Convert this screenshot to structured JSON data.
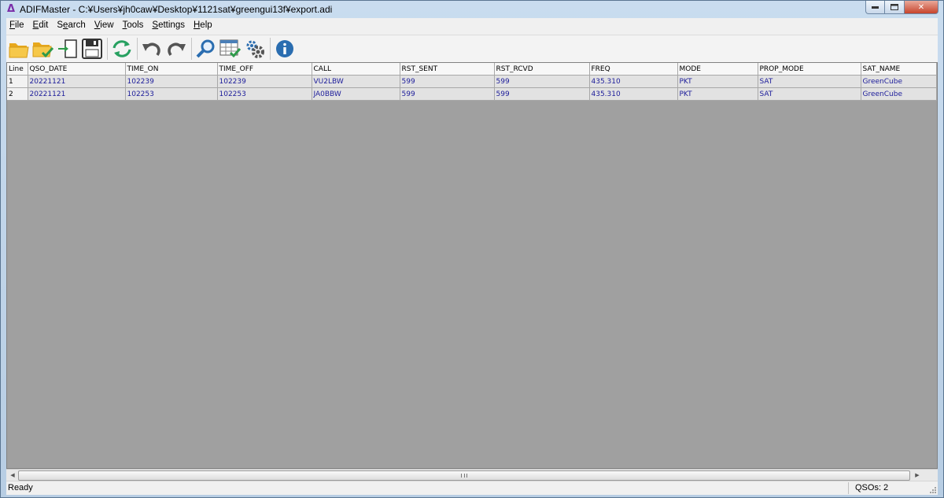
{
  "window": {
    "title": "ADIFMaster - C:¥Users¥jh0caw¥Desktop¥1121sat¥greengui13f¥export.adi",
    "icon": "adifmaster-logo-icon"
  },
  "menu": {
    "file": {
      "accel": "F",
      "rest": "ile"
    },
    "edit": {
      "accel": "E",
      "rest": "dit"
    },
    "search": {
      "pre": "S",
      "accel": "e",
      "rest": "arch"
    },
    "view": {
      "accel": "V",
      "rest": "iew"
    },
    "tools": {
      "accel": "T",
      "rest": "ools"
    },
    "settings": {
      "accel": "S",
      "rest": "ettings"
    },
    "help": {
      "accel": "H",
      "rest": "elp"
    }
  },
  "toolbar": {
    "icons": [
      "open-folder-icon",
      "open-verify-folder-icon",
      "import-icon",
      "save-icon",
      "refresh-icon",
      "undo-icon",
      "redo-icon",
      "search-icon",
      "table-check-icon",
      "settings-gears-icon",
      "info-icon"
    ]
  },
  "grid": {
    "columns": [
      "Line",
      "QSO_DATE",
      "TIME_ON",
      "TIME_OFF",
      "CALL",
      "RST_SENT",
      "RST_RCVD",
      "FREQ",
      "MODE",
      "PROP_MODE",
      "SAT_NAME"
    ],
    "rows": [
      [
        "1",
        "20221121",
        "102239",
        "102239",
        "VU2LBW",
        "599",
        "599",
        "435.310",
        "PKT",
        "SAT",
        "GreenCube"
      ],
      [
        "2",
        "20221121",
        "102253",
        "102253",
        "JA0BBW",
        "599",
        "599",
        "435.310",
        "PKT",
        "SAT",
        "GreenCube"
      ]
    ],
    "colors": {
      "cell_text": "#1c1c9a",
      "row_bg": "#e2e2e2",
      "empty_bg": "#a0a0a0"
    }
  },
  "status": {
    "left": "Ready",
    "right": "QSOs: 2"
  }
}
